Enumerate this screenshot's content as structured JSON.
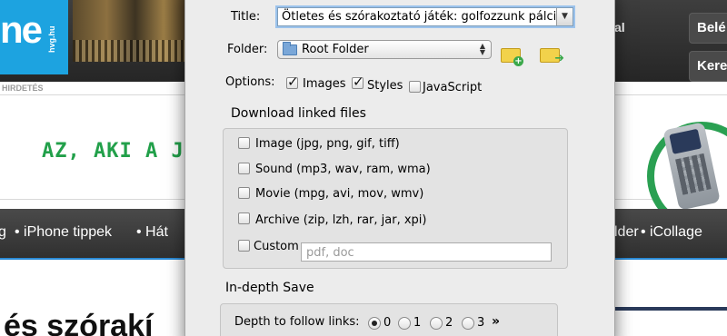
{
  "background": {
    "logo_text": "ne",
    "logo_sub": "hvg.hu",
    "header_right_text": "al",
    "header_buttons": [
      "Belé",
      "Kere"
    ],
    "ad_label": "HIRDETÉS",
    "ad_text": "AZ, AKI A JEG",
    "nav_items": [
      "g",
      "•  iPhone tippek",
      "•  Hát",
      "lder",
      "•  iCollage"
    ],
    "big_title": "és szórakí"
  },
  "dialog": {
    "title_label": "Title:",
    "title_value": "Ötletes és szórakoztató játék: golfozzunk pálcik",
    "folder_label": "Folder:",
    "folder_value": "Root Folder",
    "options_label": "Options:",
    "options": [
      {
        "label": "Images",
        "checked": true
      },
      {
        "label": "Styles",
        "checked": true
      },
      {
        "label": "JavaScript",
        "checked": false
      }
    ],
    "download_title": "Download linked files",
    "file_types": [
      {
        "label": "Image (jpg, png, gif, tiff)",
        "checked": false
      },
      {
        "label": "Sound (mp3, wav, ram, wma)",
        "checked": false
      },
      {
        "label": "Movie (mpg, avi, mov, wmv)",
        "checked": false
      },
      {
        "label": "Archive (zip, lzh, rar, jar, xpi)",
        "checked": false
      }
    ],
    "custom_label": "Custom",
    "custom_placeholder": "pdf, doc",
    "indepth_title": "In-depth Save",
    "depth_label": "Depth to follow links:",
    "depth_options": [
      "0",
      "1",
      "2",
      "3"
    ],
    "depth_selected": "0",
    "more_label": "»"
  }
}
